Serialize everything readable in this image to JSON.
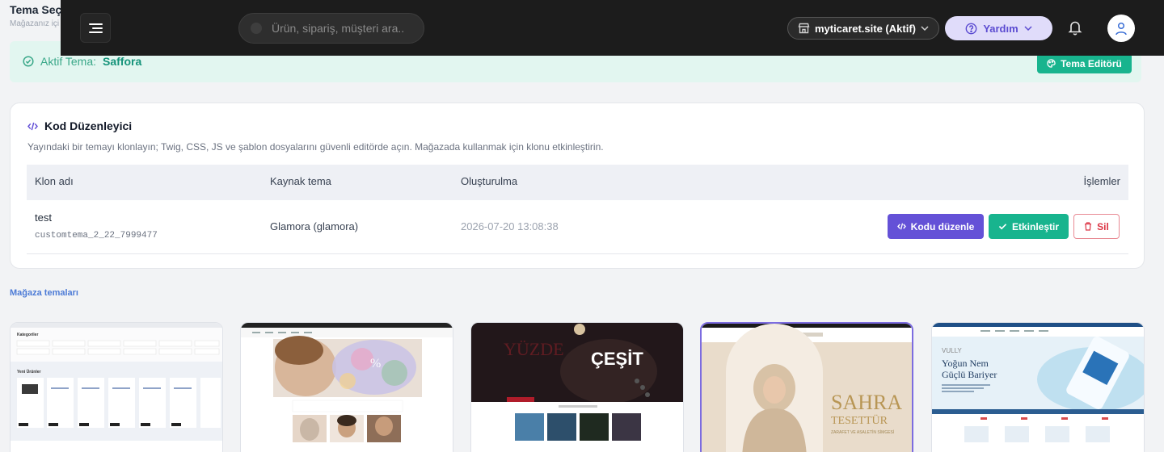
{
  "page": {
    "title": "Tema Seç",
    "subtitle": "Mağazanız içi"
  },
  "topbar": {
    "search_placeholder": "Ürün, sipariş, müşteri ara..",
    "site_label": "myticaret.site (Aktif)",
    "help_label": "Yardım"
  },
  "active_theme": {
    "label": "Aktif Tema:",
    "name": "Saffora",
    "editor_button": "Tema Editörü"
  },
  "code_editor": {
    "title": "Kod Düzenleyici",
    "description": "Yayındaki bir temayı klonlayın; Twig, CSS, JS ve şablon dosyalarını güvenli editörde açın. Mağazada kullanmak için klonu etkinleştirin.",
    "columns": [
      "Klon adı",
      "Kaynak tema",
      "Oluşturulma",
      "İşlemler"
    ],
    "rows": [
      {
        "name": "test",
        "code": "customtema_2_22_7999477",
        "source": "Glamora (glamora)",
        "created": "2026-07-20 13:08:38"
      }
    ],
    "actions": {
      "edit": "Kodu düzenle",
      "activate": "Etkinleştir",
      "delete": "Sil"
    }
  },
  "store_themes": {
    "title": "Mağaza temaları",
    "thumb_texts": {
      "t1_categories": "Kategoriler",
      "t1_new": "Yeni Ürünler",
      "t3_big": "ÇEŞİT",
      "t4_brand": "SAHRA",
      "t4_brand2": "TESETTÜR",
      "t4_tag": "ZARAFET VE ASALETİN SİMGESİ",
      "t5_h1": "Yoğun Nem",
      "t5_h2": "Güçlü Bariyer",
      "t5_brand": "VULLY"
    }
  },
  "colors": {
    "accent_purple": "#6451d7",
    "accent_green": "#18b48e",
    "danger": "#dc3545",
    "topbar_bg": "#1c1c1c"
  }
}
